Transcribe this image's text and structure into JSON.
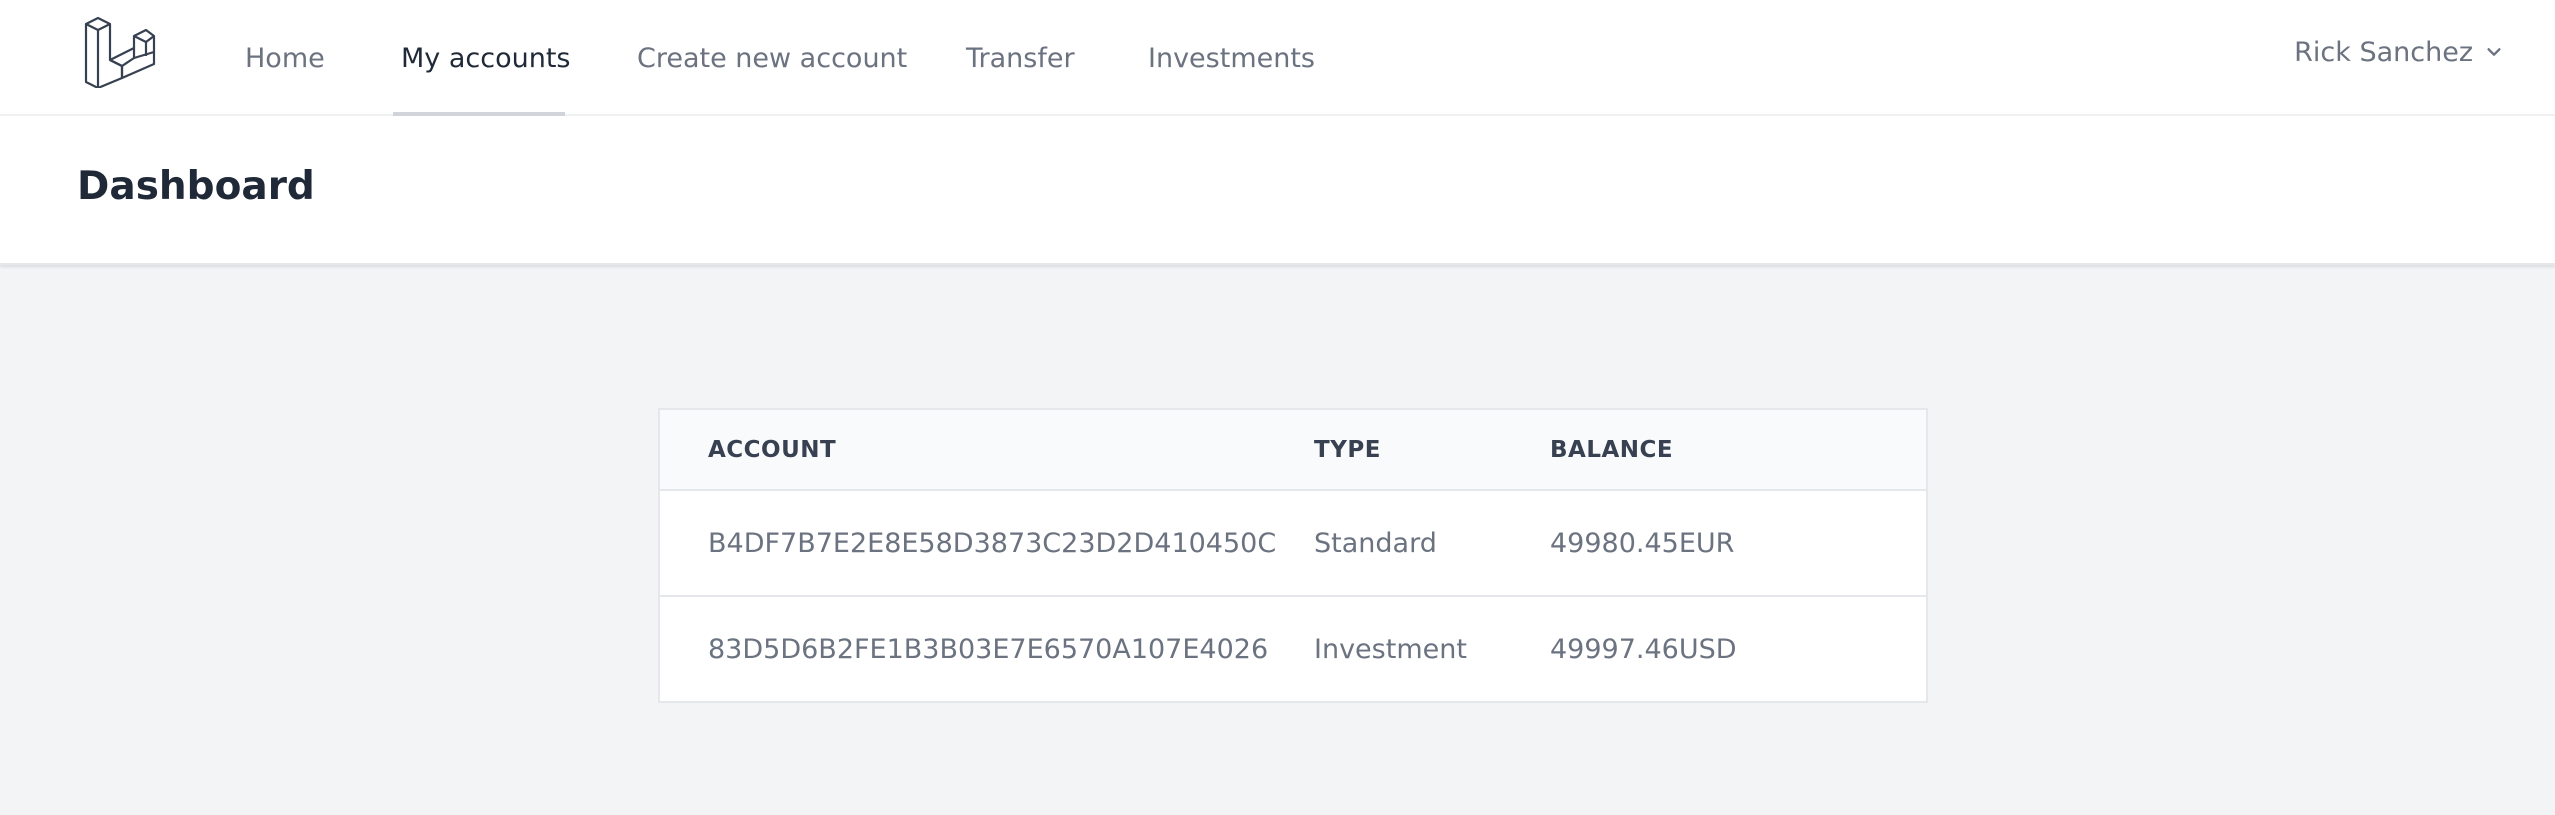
{
  "nav": {
    "logo_icon": "laravel-logo-icon",
    "links": [
      {
        "label": "Home"
      },
      {
        "label": "My accounts"
      },
      {
        "label": "Create new account"
      },
      {
        "label": "Transfer"
      },
      {
        "label": "Investments"
      }
    ],
    "active_link": "My accounts",
    "user": {
      "name": "Rick Sanchez",
      "icon": "chevron-down-icon"
    }
  },
  "header": {
    "title": "Dashboard"
  },
  "accounts_table": {
    "columns": [
      "ACCOUNT",
      "TYPE",
      "BALANCE"
    ],
    "rows": [
      {
        "account": "B4DF7B7E2E8E58D3873C23D2D410450C",
        "type": "Standard",
        "balance": "49980.45EUR"
      },
      {
        "account": "83D5D6B2FE1B3B03E7E6570A107E4026",
        "type": "Investment",
        "balance": "49997.46USD"
      }
    ]
  },
  "colors": {
    "background": "#f3f4f6",
    "surface": "#ffffff",
    "text_primary": "#1f2937",
    "text_muted": "#6b7280",
    "border": "#e5e7eb"
  }
}
